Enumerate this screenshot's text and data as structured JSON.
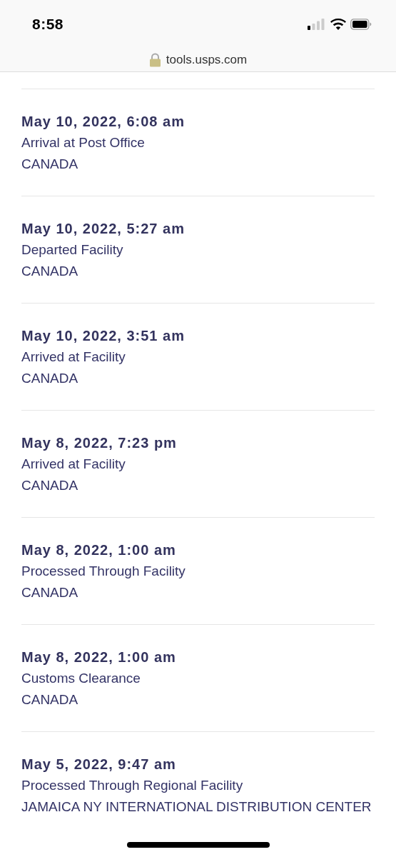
{
  "status_bar": {
    "time": "8:58"
  },
  "address_bar": {
    "url": "tools.usps.com"
  },
  "events": [
    {
      "datetime": "May 10, 2022, 6:08 am",
      "status": "Arrival at Post Office",
      "location": "CANADA"
    },
    {
      "datetime": "May 10, 2022, 5:27 am",
      "status": "Departed Facility",
      "location": "CANADA"
    },
    {
      "datetime": "May 10, 2022, 3:51 am",
      "status": "Arrived at Facility",
      "location": "CANADA"
    },
    {
      "datetime": "May 8, 2022, 7:23 pm",
      "status": "Arrived at Facility",
      "location": "CANADA"
    },
    {
      "datetime": "May 8, 2022, 1:00 am",
      "status": "Processed Through Facility",
      "location": "CANADA"
    },
    {
      "datetime": "May 8, 2022, 1:00 am",
      "status": "Customs Clearance",
      "location": "CANADA"
    },
    {
      "datetime": "May 5, 2022, 9:47 am",
      "status": "Processed Through Regional Facility",
      "location": "JAMAICA NY INTERNATIONAL DISTRIBUTION CENTER"
    }
  ]
}
